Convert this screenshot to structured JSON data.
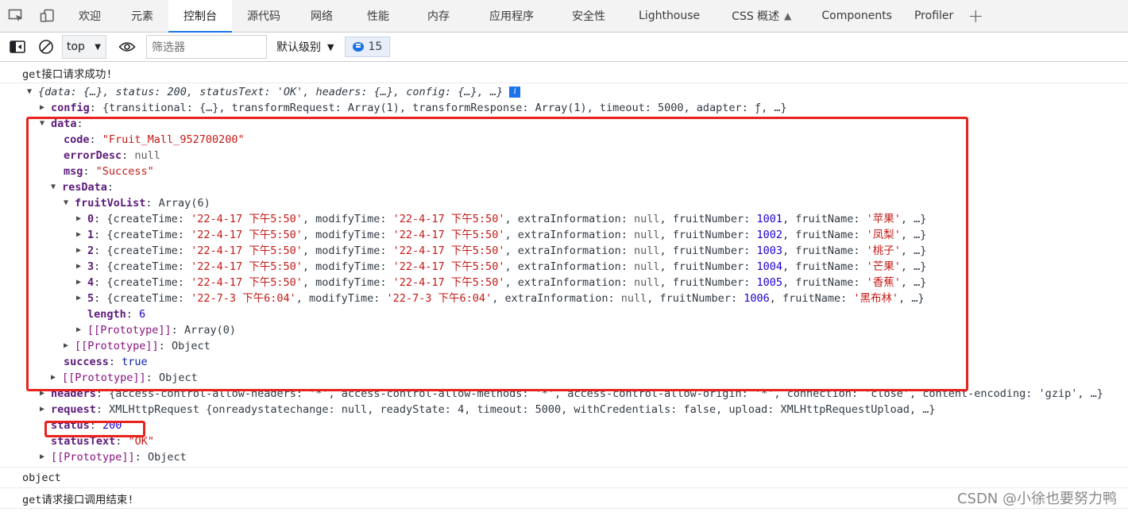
{
  "tabs": [
    "欢迎",
    "元素",
    "控制台",
    "源代码",
    "网络",
    "性能",
    "内存",
    "应用程序",
    "安全性",
    "Lighthouse",
    "CSS 概述",
    "Components",
    "Profiler"
  ],
  "active_tab": "控制台",
  "toolbar": {
    "context": "top",
    "filter_placeholder": "筛选器",
    "levels": "默认级别",
    "message_count": "15"
  },
  "console": {
    "msg1": "get接口请求成功!",
    "summary": "{data: {…}, status: 200, statusText: 'OK', headers: {…}, config: {…}, …}",
    "config_key": "config",
    "config_val": "{transitional: {…}, transformRequest: Array(1), transformResponse: Array(1), timeout: 5000, adapter: ƒ, …}",
    "data_key": "data",
    "code_key": "code",
    "code_val": "\"Fruit_Mall_952700200\"",
    "errorDesc_key": "errorDesc",
    "errorDesc_val": "null",
    "msg_key": "msg",
    "msg_val": "\"Success\"",
    "resData_key": "resData",
    "fruitVoList_key": "fruitVoList",
    "fruitVoList_val": "Array(6)",
    "fruits": [
      {
        "idx": "0",
        "ct": "'22-4-17 下午5:50'",
        "mt": "'22-4-17 下午5:50'",
        "num": "1001",
        "name": "'苹果'"
      },
      {
        "idx": "1",
        "ct": "'22-4-17 下午5:50'",
        "mt": "'22-4-17 下午5:50'",
        "num": "1002",
        "name": "'凤梨'"
      },
      {
        "idx": "2",
        "ct": "'22-4-17 下午5:50'",
        "mt": "'22-4-17 下午5:50'",
        "num": "1003",
        "name": "'桃子'"
      },
      {
        "idx": "3",
        "ct": "'22-4-17 下午5:50'",
        "mt": "'22-4-17 下午5:50'",
        "num": "1004",
        "name": "'芒果'"
      },
      {
        "idx": "4",
        "ct": "'22-4-17 下午5:50'",
        "mt": "'22-4-17 下午5:50'",
        "num": "1005",
        "name": "'香蕉'"
      },
      {
        "idx": "5",
        "ct": "'22-7-3 下午6:04'",
        "mt": "'22-7-3 下午6:04'",
        "num": "1006",
        "name": "'黑布林'"
      }
    ],
    "length_key": "length",
    "length_val": "6",
    "proto_key": "[[Prototype]]",
    "proto_array": "Array(0)",
    "proto_object": "Object",
    "success_key": "success",
    "success_val": "true",
    "headers_key": "headers",
    "headers_val": "{access-control-allow-headers: '*', access-control-allow-methods: '*', access-control-allow-origin: '*', connection: 'close', content-encoding: 'gzip', …}",
    "request_key": "request",
    "request_val": "XMLHttpRequest {onreadystatechange: null, readyState: 4, timeout: 5000, withCredentials: false, upload: XMLHttpRequestUpload, …}",
    "status_key": "status",
    "status_val": "200",
    "statusText_key": "statusText",
    "statusText_val": "\"OK\"",
    "msg2": "object",
    "msg3": "get请求接口调用结束!"
  },
  "watermark": "CSDN @小徐也要努力鸭",
  "colors": {
    "accent": "#1a73e8",
    "highlight_box": "#e8231f"
  }
}
